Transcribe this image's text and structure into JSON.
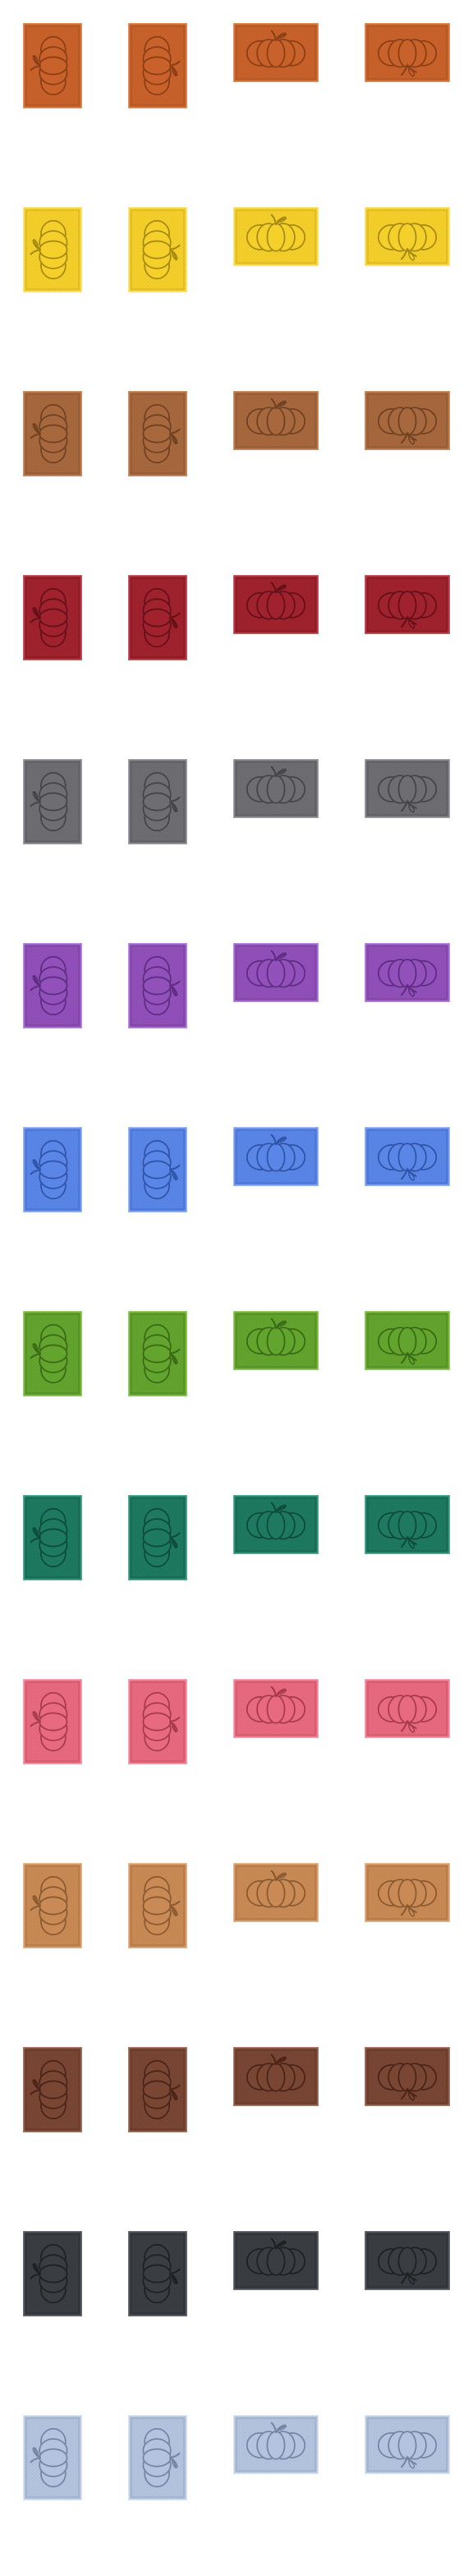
{
  "sprite_sheet": {
    "orientations": [
      "vertical-left",
      "vertical-right",
      "horizontal-up",
      "horizontal-down"
    ],
    "icon": "pumpkin-icon",
    "colors": [
      {
        "name": "orange",
        "fill": "#c8622a",
        "border": "#e0905a",
        "line": "#8a3f16"
      },
      {
        "name": "yellow",
        "fill": "#f5d02b",
        "border": "#fbe678",
        "line": "#a68a12"
      },
      {
        "name": "brown",
        "fill": "#a8683e",
        "border": "#c99068",
        "line": "#6e4222"
      },
      {
        "name": "red",
        "fill": "#a0222e",
        "border": "#c85a64",
        "line": "#641018"
      },
      {
        "name": "gray",
        "fill": "#6e6d72",
        "border": "#a2a1a6",
        "line": "#45444a"
      },
      {
        "name": "purple",
        "fill": "#9150ba",
        "border": "#bd8ae0",
        "line": "#5e2c80"
      },
      {
        "name": "blue",
        "fill": "#5a86e8",
        "border": "#9ab6f4",
        "line": "#2f54a8"
      },
      {
        "name": "green",
        "fill": "#62a42e",
        "border": "#94ce62",
        "line": "#3a6a16"
      },
      {
        "name": "teal",
        "fill": "#1d7a60",
        "border": "#52ae94",
        "line": "#0e4a3a"
      },
      {
        "name": "pink",
        "fill": "#e86a80",
        "border": "#f6a4b2",
        "line": "#a83a4e"
      },
      {
        "name": "tan",
        "fill": "#c98a56",
        "border": "#e6b88e",
        "line": "#8a5a30"
      },
      {
        "name": "dark-brown",
        "fill": "#7a4634",
        "border": "#a87664",
        "line": "#4a2418"
      },
      {
        "name": "charcoal",
        "fill": "#3a3e42",
        "border": "#6a6e72",
        "line": "#1e2124"
      },
      {
        "name": "light-blue",
        "fill": "#b4c4de",
        "border": "#dae4f2",
        "line": "#7486a4"
      }
    ]
  }
}
